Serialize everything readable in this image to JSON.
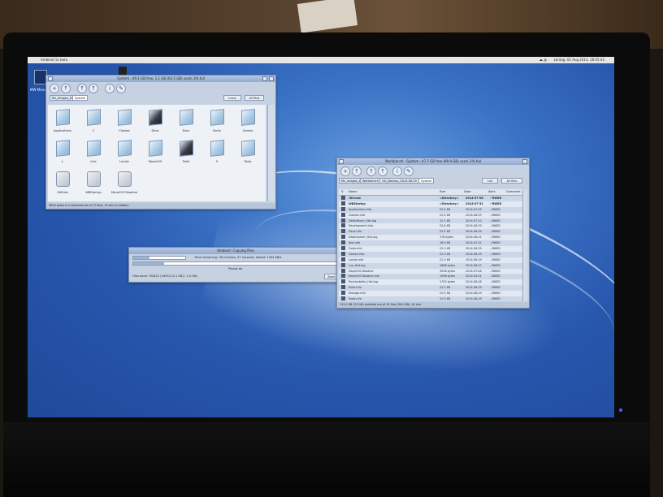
{
  "screen_bar": {
    "title": "Ambient 5c beta",
    "clock": "Lördag, 02 Aug 2014, 18:05:45"
  },
  "desktop": {
    "icon_label": "MW Menu"
  },
  "drawer_window": {
    "title": "System : 49.1 GB free, 1.1 GB (63.5 GB) used, 3% full",
    "tabs": [
      "Ms_Images_D:",
      "System"
    ],
    "buttons": {
      "icons": "Icons",
      "all_files": "All files"
    },
    "icons": [
      {
        "label": "Applications",
        "type": "folder"
      },
      {
        "label": "C",
        "type": "folder"
      },
      {
        "label": "Classes",
        "type": "folder"
      },
      {
        "label": "Devs",
        "type": "folder-dark"
      },
      {
        "label": "Docs",
        "type": "folder"
      },
      {
        "label": "Fonts",
        "type": "folder"
      },
      {
        "label": "Games",
        "type": "folder"
      },
      {
        "label": "L",
        "type": "folder"
      },
      {
        "label": "Libs",
        "type": "folder"
      },
      {
        "label": "Locale",
        "type": "folder"
      },
      {
        "label": "MorphOS",
        "type": "folder"
      },
      {
        "label": "Prefs",
        "type": "folder-dark"
      },
      {
        "label": "S",
        "type": "folder"
      },
      {
        "label": "Tools",
        "type": "folder"
      },
      {
        "label": "Utilities",
        "type": "gear"
      },
      {
        "label": "WBStartup",
        "type": "gear"
      },
      {
        "label": "MorphOS Readme",
        "type": "gear"
      }
    ],
    "status": "3894 bytes in 0 selected out of 17 files, 13 dirs (0 hidden)"
  },
  "copy_dialog": {
    "title": "Ambient: Copying Files",
    "time_remaining": "Time remaining: 38 minutes, 27 seconds, Speed: 1344 KB/s",
    "label": "Please do",
    "file_line": "Files done: 95/612 (34953 (0.1 GB) / 1.0 GB)",
    "abort": "Abort",
    "progress_top": 0.08,
    "progress_bottom": 0.15
  },
  "list_window": {
    "title": "Workbench : System : 47.7 GB free (89.9 GB) used, 2% full",
    "tabs": [
      "Ms_Images_D:",
      "Workbench",
      "GG_Backup_2014.06.29",
      "System"
    ],
    "buttons": {
      "list": "List",
      "all_files": "All files"
    },
    "columns": [
      "Name",
      "Size",
      "Date",
      "Attrs",
      "Comment"
    ],
    "rows": [
      {
        "name": "!Dirnew",
        "size": "<Directory>",
        "date": "2014-07-06",
        "attr": "--RWED",
        "bold": true
      },
      {
        "name": "WBStartup",
        "size": "<Directory>",
        "date": "2014-07-31",
        "attr": "--RWED",
        "bold": true
      },
      {
        "name": "Applications.info",
        "size": "22.5 KB",
        "date": "2014-07-03",
        "attr": "--RWED"
      },
      {
        "name": "Classes.info",
        "size": "22.3 KB",
        "date": "2014-06-29",
        "attr": "--RWED"
      },
      {
        "name": "DefaultIcon_Hist.log",
        "size": "12.1 KB",
        "date": "2014-07-10",
        "attr": "--RWED"
      },
      {
        "name": "Development.info",
        "size": "22.6 KB",
        "date": "2014-06-29",
        "attr": "--RWED"
      },
      {
        "name": "Devs.info",
        "size": "22.5 KB",
        "date": "2014-06-29",
        "attr": "--RWED"
      },
      {
        "name": "DiskInstaller_Hist.log",
        "size": "178 bytes",
        "date": "2014-06-01",
        "attr": "--RWED"
      },
      {
        "name": "disk.info",
        "size": "18.9 KB",
        "date": "2014-07-01",
        "attr": "--RWED"
      },
      {
        "name": "Fonts.info",
        "size": "22.3 KB",
        "date": "2014-06-29",
        "attr": "--RWED"
      },
      {
        "name": "Games.info",
        "size": "22.3 KB",
        "date": "2014-06-29",
        "attr": "--RWED"
      },
      {
        "name": "Locale.info",
        "size": "22.3 KB",
        "date": "2014-06-29",
        "attr": "--RWED"
      },
      {
        "name": "Lua_Hist.log",
        "size": "1888 bytes",
        "date": "2014-06-27",
        "attr": "--RWED"
      },
      {
        "name": "MorphOS.Readme",
        "size": "3926 bytes",
        "date": "2014-07-06",
        "attr": "--RWED"
      },
      {
        "name": "MorphOS.Readme.info",
        "size": "1998 bytes",
        "date": "2014-03-01",
        "attr": "--RWED"
      },
      {
        "name": "PackInstaller_Hist.log",
        "size": "1702 bytes",
        "date": "2014-06-28",
        "attr": "--RWED"
      },
      {
        "name": "Prefs.info",
        "size": "22.1 KB",
        "date": "2014-06-29",
        "attr": "--RWED"
      },
      {
        "name": "Storage.info",
        "size": "22.5 KB",
        "date": "2014-06-29",
        "attr": "--RWED"
      },
      {
        "name": "Tools.info",
        "size": "22.9 KB",
        "date": "2014-06-29",
        "attr": "--RWED"
      },
      {
        "name": "Utilities.info",
        "size": "22.7 KB",
        "date": "2014-06-29",
        "attr": "--RWED"
      },
      {
        "name": "WBStartup.info",
        "size": "22.1 KB",
        "date": "2014-06-29",
        "attr": "--RWED",
        "selected": true
      }
    ],
    "status": "113.1 KB (3.5 kB) selected out of 19 files (58.0 KB), 41 dirs"
  }
}
